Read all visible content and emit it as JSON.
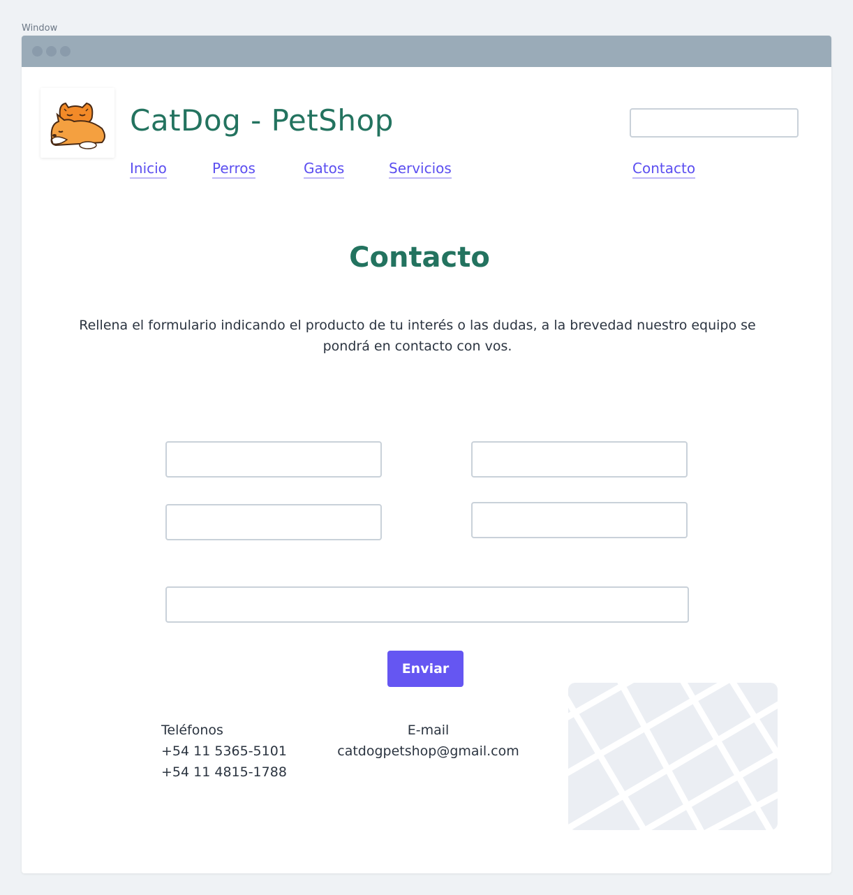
{
  "window": {
    "label": "Window"
  },
  "header": {
    "site_title": "CatDog - PetShop",
    "search_value": ""
  },
  "nav": {
    "items": [
      {
        "label": "Inicio"
      },
      {
        "label": "Perros"
      },
      {
        "label": "Gatos"
      },
      {
        "label": "Servicios"
      },
      {
        "label": "Contacto"
      }
    ]
  },
  "main": {
    "heading": "Contacto",
    "intro": "Rellena el formulario indicando el producto de tu interés o las dudas, a la brevedad nuestro equipo se pondrá en contacto con vos."
  },
  "form": {
    "submit_label": "Enviar"
  },
  "contact_info": {
    "phones_label": "Teléfonos",
    "phone_1": "+54 11 5365-5101",
    "phone_2": "+54 11 4815-1788",
    "email_label": "E-mail",
    "email_value": "catdogpetshop@gmail.com"
  },
  "icons": {
    "logo": "cat-dog-logo-icon",
    "map": "map-placeholder-icon"
  },
  "colors": {
    "brand_green": "#23735f",
    "link_purple": "#5b4ef0",
    "button_purple": "#6556f2"
  }
}
